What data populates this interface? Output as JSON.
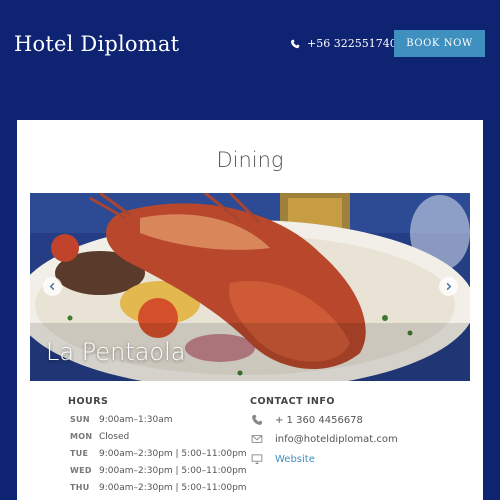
{
  "header": {
    "brand": "Hotel Diplomat",
    "phone": "+56 322551740",
    "book_label": "BOOK NOW"
  },
  "card": {
    "title": "Dining",
    "slide_caption": "La Pentaola"
  },
  "hours": {
    "heading": "HOURS",
    "rows": [
      {
        "day": "SUN",
        "time": "9:00am–1:30am"
      },
      {
        "day": "MON",
        "time": "Closed"
      },
      {
        "day": "TUE",
        "time": "9:00am–2:30pm | 5:00–11:00pm"
      },
      {
        "day": "WED",
        "time": "9:00am–2:30pm | 5:00–11:00pm"
      },
      {
        "day": "THU",
        "time": "9:00am–2:30pm | 5:00–11:00pm"
      }
    ]
  },
  "contact": {
    "heading": "CONTACT INFO",
    "phone": "+ 1 360 4456678",
    "email": "info@hoteldiplomat.com",
    "website": "Website"
  },
  "colors": {
    "page_bg": "#0e2372",
    "accent": "#3f8fbf",
    "card_bg": "#ffffff"
  },
  "icons": [
    "phone-icon",
    "chevron-left-icon",
    "chevron-right-icon",
    "envelope-icon",
    "monitor-icon"
  ]
}
